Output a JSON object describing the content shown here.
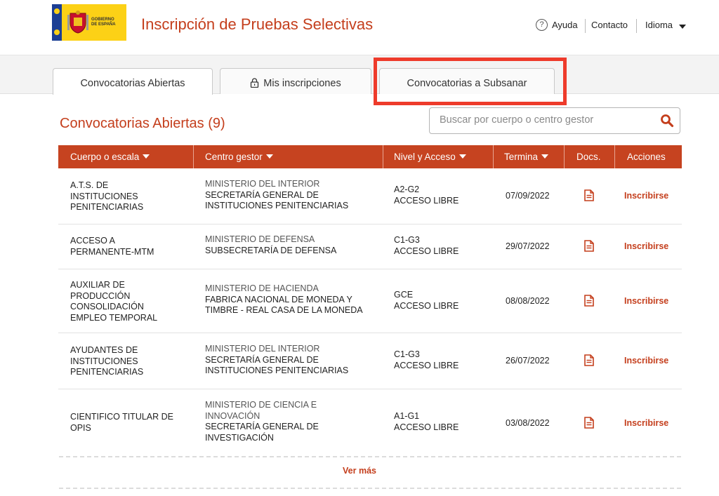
{
  "header": {
    "logo_text": "GOBIERNO\nDE ESPAÑA",
    "title": "Inscripción de Pruebas Selectivas",
    "help_label": "Ayuda",
    "contact_label": "Contacto",
    "language_label": "Idioma"
  },
  "tabs": [
    {
      "label": "Convocatorias Abiertas",
      "active": true
    },
    {
      "label": "Mis inscripciones",
      "icon": "lock-icon"
    },
    {
      "label": "Convocatorias a Subsanar"
    }
  ],
  "section": {
    "title": "Convocatorias Abiertas (9)",
    "search_placeholder": "Buscar por cuerpo o centro gestor",
    "search_value": ""
  },
  "table": {
    "columns": [
      "Cuerpo o escala",
      "Centro gestor",
      "Nivel y Acceso",
      "Termina",
      "Docs.",
      "Acciones"
    ],
    "rows": [
      {
        "cuerpo": "A.T.S. DE\nINSTITUCIONES\nPENITENCIARIAS",
        "ministerio": "MINISTERIO DEL INTERIOR",
        "centro": "SECRETARÍA GENERAL DE\nINSTITUCIONES PENITENCIARIAS",
        "nivel": "A2-G2\nACCESO LIBRE",
        "termina": "07/09/2022",
        "accion": "Inscribirse"
      },
      {
        "cuerpo": "ACCESO A\nPERMANENTE-MTM",
        "ministerio": "MINISTERIO DE DEFENSA",
        "centro": "SUBSECRETARÍA DE DEFENSA",
        "nivel": "C1-G3\nACCESO LIBRE",
        "termina": "29/07/2022",
        "accion": "Inscribirse"
      },
      {
        "cuerpo": "AUXILIAR DE\nPRODUCCIÓN\nCONSOLIDACIÓN\nEMPLEO TEMPORAL",
        "ministerio": "MINISTERIO DE HACIENDA",
        "centro": "FABRICA NACIONAL DE MONEDA Y\nTIMBRE - REAL CASA DE LA MONEDA",
        "nivel": "GCE\nACCESO LIBRE",
        "termina": "08/08/2022",
        "accion": "Inscribirse"
      },
      {
        "cuerpo": "AYUDANTES DE\nINSTITUCIONES\nPENITENCIARIAS",
        "ministerio": "MINISTERIO DEL INTERIOR",
        "centro": "SECRETARÍA GENERAL DE\nINSTITUCIONES PENITENCIARIAS",
        "nivel": "C1-G3\nACCESO LIBRE",
        "termina": "26/07/2022",
        "accion": "Inscribirse"
      },
      {
        "cuerpo": "CIENTIFICO TITULAR DE\nOPIS",
        "ministerio": "MINISTERIO DE CIENCIA E\nINNOVACIÓN",
        "centro": "SECRETARÍA GENERAL DE\nINVESTIGACIÓN",
        "nivel": "A1-G1\nACCESO LIBRE",
        "termina": "03/08/2022",
        "accion": "Inscribirse"
      }
    ]
  },
  "more_label": "Ver más",
  "colors": {
    "brand": "#c43e1c",
    "header_bg": "#c64320",
    "highlight": "#ee3b2b"
  }
}
